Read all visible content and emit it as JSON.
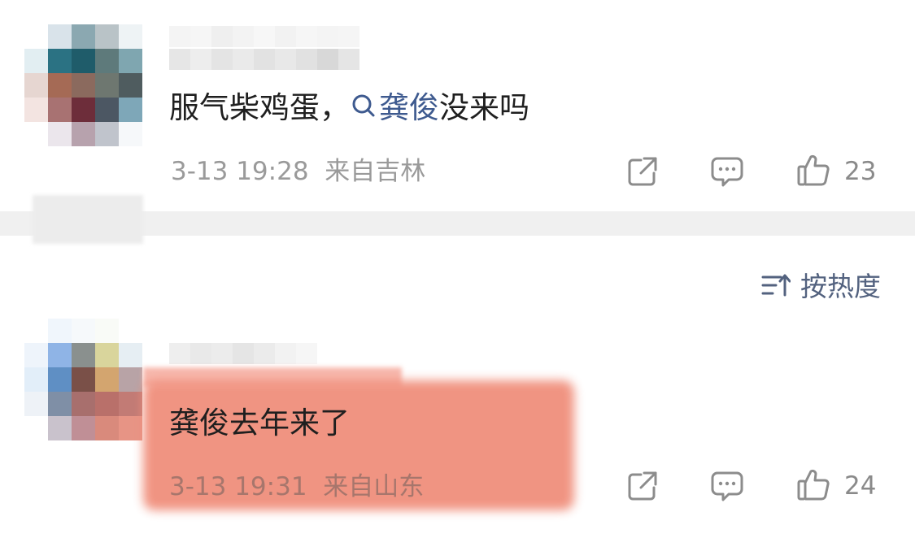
{
  "comment1": {
    "text_prefix": "服气柴鸡蛋，",
    "topic": "龚俊",
    "text_suffix": "没来吗",
    "time": "3-13 19:28",
    "location": "来自吉林",
    "likes": "23"
  },
  "sort": {
    "label": "按热度"
  },
  "comment2": {
    "text": "龚俊去年来了",
    "time": "3-13 19:31",
    "location": "来自山东",
    "likes": "24"
  },
  "icons": {
    "share": "share-icon",
    "comment": "comment-icon",
    "like": "thumbs-up-icon",
    "sort": "sort-icon",
    "search": "search-icon"
  },
  "colors": {
    "topic_link": "#3e5a8f",
    "text": "#1f1f1f",
    "meta": "#9a9a9a",
    "highlight": "#f08f7c"
  }
}
